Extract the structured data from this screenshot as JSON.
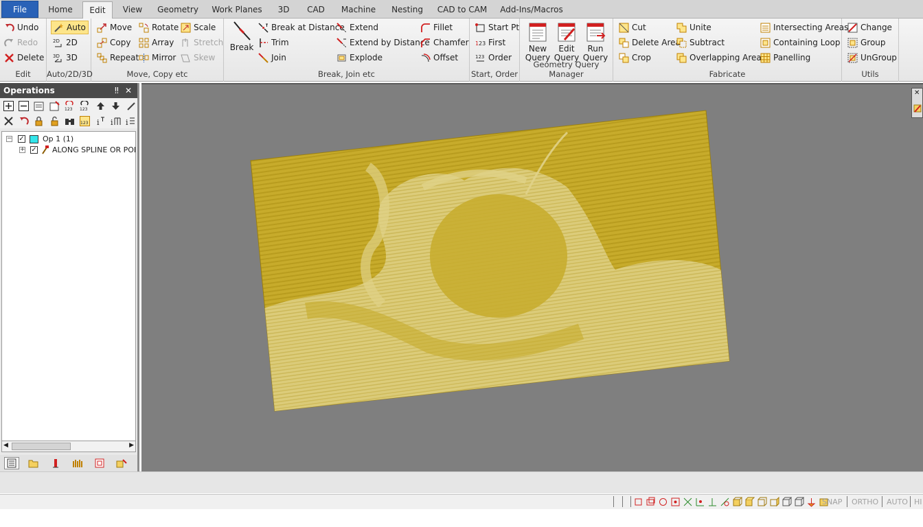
{
  "tabs": [
    {
      "label": "File"
    },
    {
      "label": "Home"
    },
    {
      "label": "Edit"
    },
    {
      "label": "View"
    },
    {
      "label": "Geometry"
    },
    {
      "label": "Work Planes"
    },
    {
      "label": "3D"
    },
    {
      "label": "CAD"
    },
    {
      "label": "Machine"
    },
    {
      "label": "Nesting"
    },
    {
      "label": "CAD to CAM"
    },
    {
      "label": "Add-Ins/Macros"
    }
  ],
  "ribbon": {
    "edit": {
      "label": "Edit",
      "undo": "Undo",
      "redo": "Redo",
      "delete": "Delete"
    },
    "auto": {
      "label": "Auto/2D/3D",
      "auto": "Auto",
      "two_d": "2D",
      "three_d": "3D"
    },
    "move": {
      "label": "Move, Copy etc",
      "move": "Move",
      "copy": "Copy",
      "repeat": "Repeat",
      "rotate": "Rotate",
      "array": "Array",
      "mirror": "Mirror",
      "scale": "Scale",
      "stretch": "Stretch",
      "skew": "Skew"
    },
    "break": {
      "label": "Break, Join etc",
      "break": "Break",
      "break_at_distance": "Break at Distance",
      "trim": "Trim",
      "join": "Join",
      "extend": "Extend",
      "extend_by_distance": "Extend by Distance",
      "explode": "Explode",
      "fillet": "Fillet",
      "chamfer": "Chamfer",
      "offset": "Offset"
    },
    "start": {
      "label": "Start, Order",
      "start_pt": "Start Pt",
      "first": "First",
      "order": "Order"
    },
    "query": {
      "label": "Geometry Query Manager",
      "new_query": [
        "New",
        "Query"
      ],
      "edit_query": [
        "Edit",
        "Query"
      ],
      "run_query": [
        "Run",
        "Query"
      ]
    },
    "fabricate": {
      "label": "Fabricate",
      "cut": "Cut",
      "delete_area": "Delete Area",
      "crop": "Crop",
      "unite": "Unite",
      "subtract": "Subtract",
      "overlapping_areas": "Overlapping Areas",
      "intersecting_areas": "Intersecting Areas",
      "containing_loop": "Containing Loop",
      "panelling": "Panelling"
    },
    "utils": {
      "label": "Utils",
      "change": "Change",
      "group": "Group",
      "ungroup": "UnGroup"
    }
  },
  "operations": {
    "title": "Operations",
    "tree": [
      {
        "label": "Op 1   (1)",
        "color": "#33e5ea"
      },
      {
        "label": "ALONG SPLINE OR POLYLINE"
      }
    ]
  },
  "status": {
    "snap": "SNAP",
    "ortho": "ORTHO",
    "auto": "AUTO",
    "hi": "HI"
  },
  "colors": {
    "accent": "#2a62b7",
    "viewport": "#7f7f7f",
    "toolpath": "#c8ad2d",
    "toolpath_light": "#e6d88f"
  }
}
